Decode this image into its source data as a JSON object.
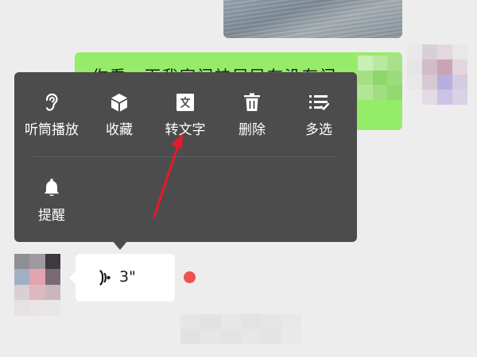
{
  "colors": {
    "page_background": "#ededed",
    "menu_background": "#4c4c4c",
    "outgoing_bubble": "#95ec69",
    "incoming_bubble": "#ffffff",
    "unread_dot": "#f0514e",
    "annotation_arrow": "#e8192c"
  },
  "chat": {
    "outgoing_text": "你看，下我家门神居民在没有门",
    "voice_message": {
      "duration": "3\""
    }
  },
  "context_menu": {
    "items": [
      {
        "label": "听筒播放",
        "icon": "ear-icon"
      },
      {
        "label": "收藏",
        "icon": "cube-icon"
      },
      {
        "label": "转文字",
        "icon": "text-convert-icon"
      },
      {
        "label": "删除",
        "icon": "trash-icon"
      },
      {
        "label": "多选",
        "icon": "multi-select-icon"
      },
      {
        "label": "提醒",
        "icon": "bell-icon"
      }
    ]
  }
}
